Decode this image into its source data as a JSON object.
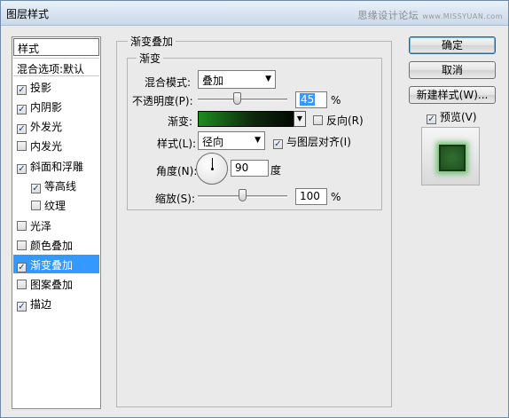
{
  "window": {
    "title": "图层样式",
    "watermark": "思缘设计论坛",
    "watermark_site": "www.MISSYUAN.com"
  },
  "styles_panel": {
    "header": "样式",
    "blend_options": "混合选项:默认",
    "items": [
      {
        "label": "投影",
        "checked": true,
        "indent": false,
        "selected": false
      },
      {
        "label": "内阴影",
        "checked": true,
        "indent": false,
        "selected": false
      },
      {
        "label": "外发光",
        "checked": true,
        "indent": false,
        "selected": false
      },
      {
        "label": "内发光",
        "checked": false,
        "indent": false,
        "selected": false
      },
      {
        "label": "斜面和浮雕",
        "checked": true,
        "indent": false,
        "selected": false
      },
      {
        "label": "等高线",
        "checked": true,
        "indent": true,
        "selected": false
      },
      {
        "label": "纹理",
        "checked": false,
        "indent": true,
        "selected": false
      },
      {
        "label": "光泽",
        "checked": false,
        "indent": false,
        "selected": false
      },
      {
        "label": "颜色叠加",
        "checked": false,
        "indent": false,
        "selected": false
      },
      {
        "label": "渐变叠加",
        "checked": true,
        "indent": false,
        "selected": true
      },
      {
        "label": "图案叠加",
        "checked": false,
        "indent": false,
        "selected": false
      },
      {
        "label": "描边",
        "checked": true,
        "indent": false,
        "selected": false
      }
    ]
  },
  "gradient_overlay": {
    "outer_title": "渐变叠加",
    "inner_title": "渐变",
    "blend_mode_label": "混合模式:",
    "blend_mode_value": "叠加",
    "opacity_label": "不透明度(P):",
    "opacity_value": "45",
    "opacity_unit": "%",
    "opacity_fraction": 0.45,
    "gradient_label": "渐变:",
    "reverse_label": "反向(R)",
    "reverse_checked": false,
    "style_label": "样式(L):",
    "style_value": "径向",
    "align_label": "与图层对齐(I)",
    "align_checked": true,
    "angle_label": "角度(N):",
    "angle_value": "90",
    "angle_unit": "度",
    "scale_label": "缩放(S):",
    "scale_value": "100",
    "scale_unit": "%",
    "scale_fraction": 0.5
  },
  "buttons": {
    "ok": "确定",
    "cancel": "取消",
    "new_style": "新建样式(W)...",
    "preview_label": "预览(V)",
    "preview_checked": true
  },
  "colors": {
    "selection": "#3399ff",
    "gradient_start": "#1e8c1e",
    "gradient_end": "#000000",
    "preview_glow": "#6fbf6f"
  }
}
